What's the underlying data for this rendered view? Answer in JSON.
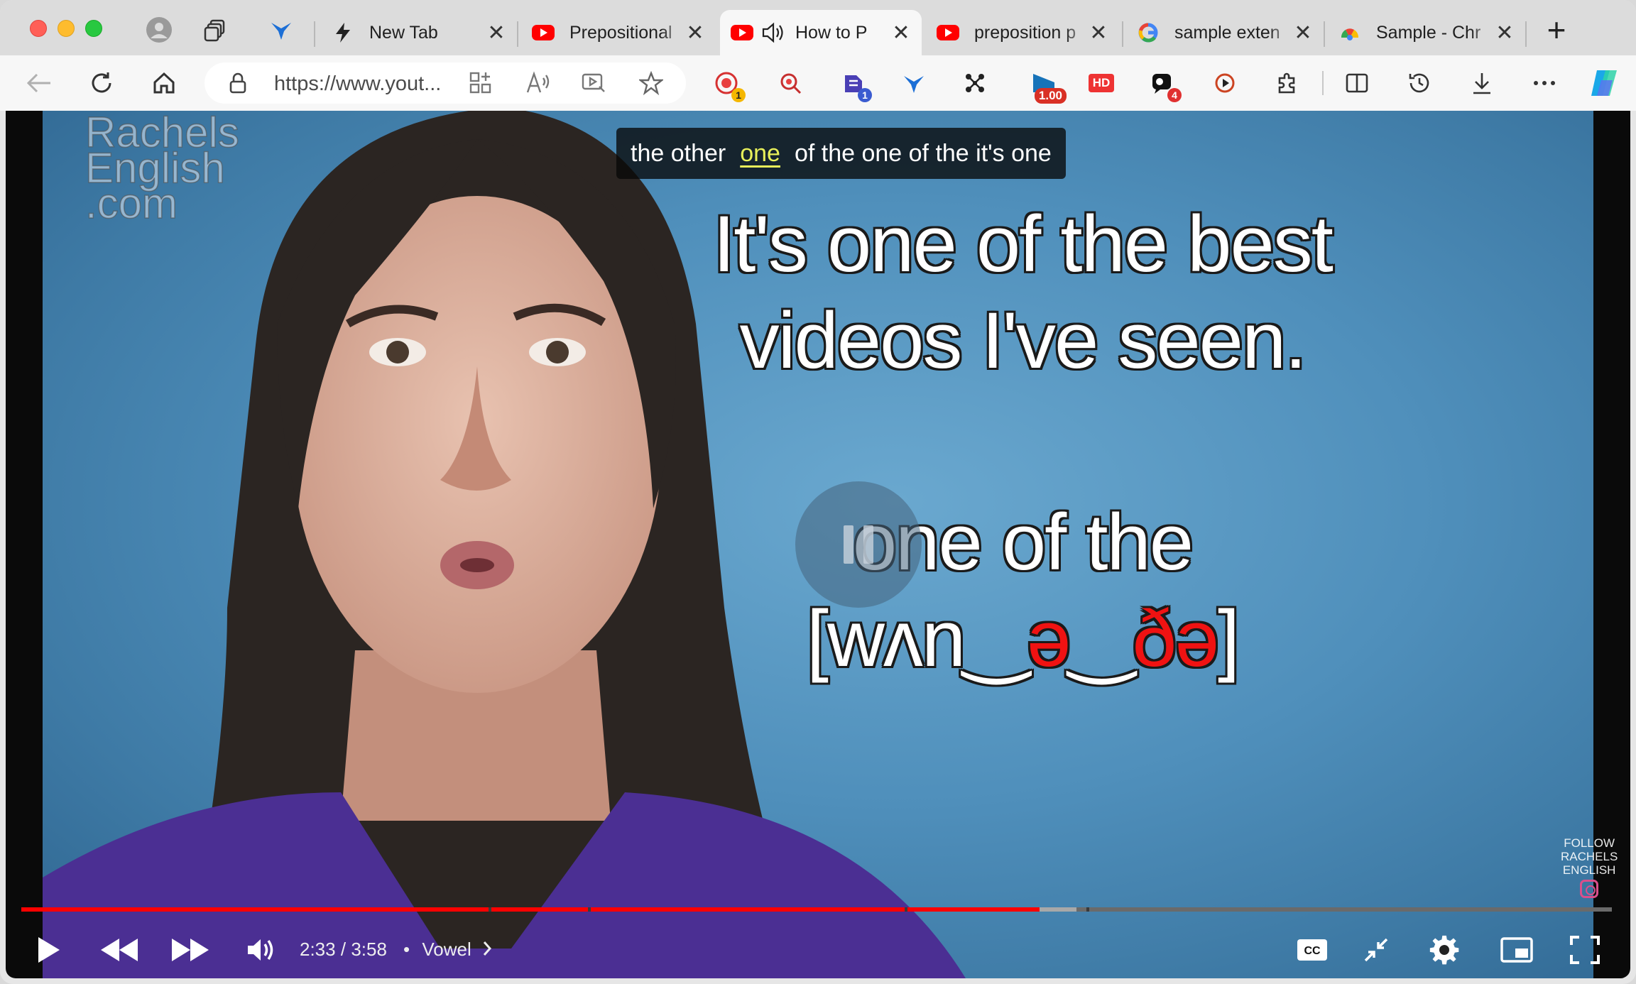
{
  "browser": {
    "tabs": [
      {
        "label": "New Tab",
        "favicon": "lightning-icon"
      },
      {
        "label": "Prepositional",
        "favicon": "youtube-icon"
      },
      {
        "label": "How to P",
        "favicon": "youtube-icon",
        "active": true,
        "audio": true
      },
      {
        "label": "preposition p",
        "favicon": "youtube-icon"
      },
      {
        "label": "sample exten",
        "favicon": "google-icon"
      },
      {
        "label": "Sample - Chr",
        "favicon": "chrome-icon"
      }
    ],
    "close_glyph": "✕",
    "new_tab_glyph": "+",
    "url": "https://www.yout...",
    "extensions": {
      "badge_1": "1",
      "badge_2": "1",
      "speed_badge": "1.00",
      "hd_label": "HD",
      "badge_4": "4"
    }
  },
  "video": {
    "watermark": [
      "Rachels",
      "English",
      ".com"
    ],
    "caption": {
      "before": "the other",
      "highlight": "one",
      "after": "of the one of the it's one"
    },
    "headline_line1": "It's one of the best",
    "headline_line2": "videos I've seen.",
    "phrase": "one of the",
    "ipa": {
      "open": "[wʌn",
      "link1": "‿",
      "schwa1": "ə",
      "link2": "‿",
      "red_part": "ðə",
      "close": "]"
    },
    "follow": [
      "FOLLOW",
      "RACHELS",
      "ENGLISH"
    ]
  },
  "player": {
    "current_time": "2:33",
    "separator": "/",
    "duration": "3:58",
    "bullet": "•",
    "chapter": "Vowel",
    "progress_played_fraction": 0.64,
    "colors": {
      "played": "#ff0000",
      "buffered": "#a8a8a8",
      "track": "#6a6a6a"
    }
  },
  "colors": {
    "accent_red": "#ff0000",
    "video_bg": "#4f8fbb"
  }
}
